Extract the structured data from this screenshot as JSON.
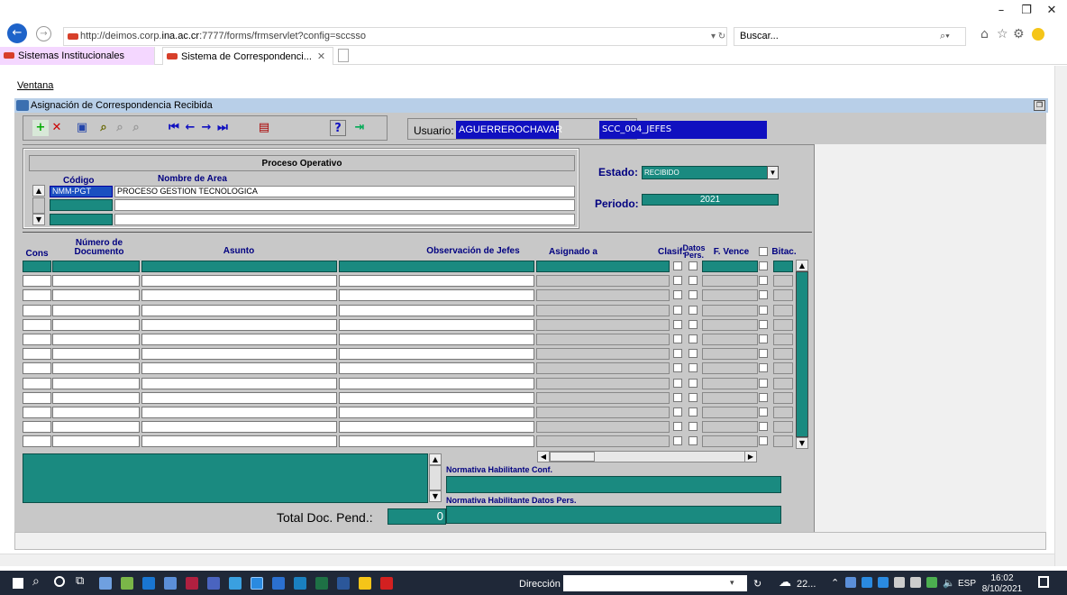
{
  "browser": {
    "url_prefix": "http://deimos.corp.",
    "url_host": "ina.ac.cr",
    "url_rest": ":7777/forms/frmservlet?config=sccsso",
    "search_placeholder": "Buscar...",
    "tabs": [
      {
        "label": "Sistemas Institucionales"
      },
      {
        "label": "Sistema de Correspondenci..."
      }
    ]
  },
  "forms": {
    "menu": "Ventana",
    "window_title": "Asignación de Correspondencia Recibida",
    "usuario_label": "Usuario:",
    "usuario_value": "AGUERREROCHAVAR",
    "rol_value": "SCC_004_JEFES",
    "proceso_title": "Proceso Operativo",
    "codigo_header": "Código",
    "area_header": "Nombre de Area",
    "codigo_value": "NMM-PGT",
    "area_value": "PROCESO GESTION TECNOLOGICA",
    "estado_label": "Estado:",
    "estado_value": "RECIBIDO",
    "periodo_label": "Periodo:",
    "periodo_value": "2021",
    "grid_headers": {
      "cons": "Cons",
      "numero": "Número de Documento",
      "asunto": "Asunto",
      "observacion": "Observación de Jefes",
      "asignado": "Asignado a",
      "clasif": "Clasif.",
      "datos": "Datos Pers.",
      "fvence": "F. Vence",
      "bitac": "Bitac."
    },
    "norm_conf_label": "Normativa Habilitante Conf.",
    "norm_datos_label": "Normativa Habilitante Datos Pers.",
    "total_label": "Total Doc. Pend.:",
    "total_value": "0"
  },
  "taskbar": {
    "direccion_label": "Dirección",
    "weather": "22...",
    "lang": "ESP",
    "time": "16:02",
    "date": "8/10/2021"
  }
}
